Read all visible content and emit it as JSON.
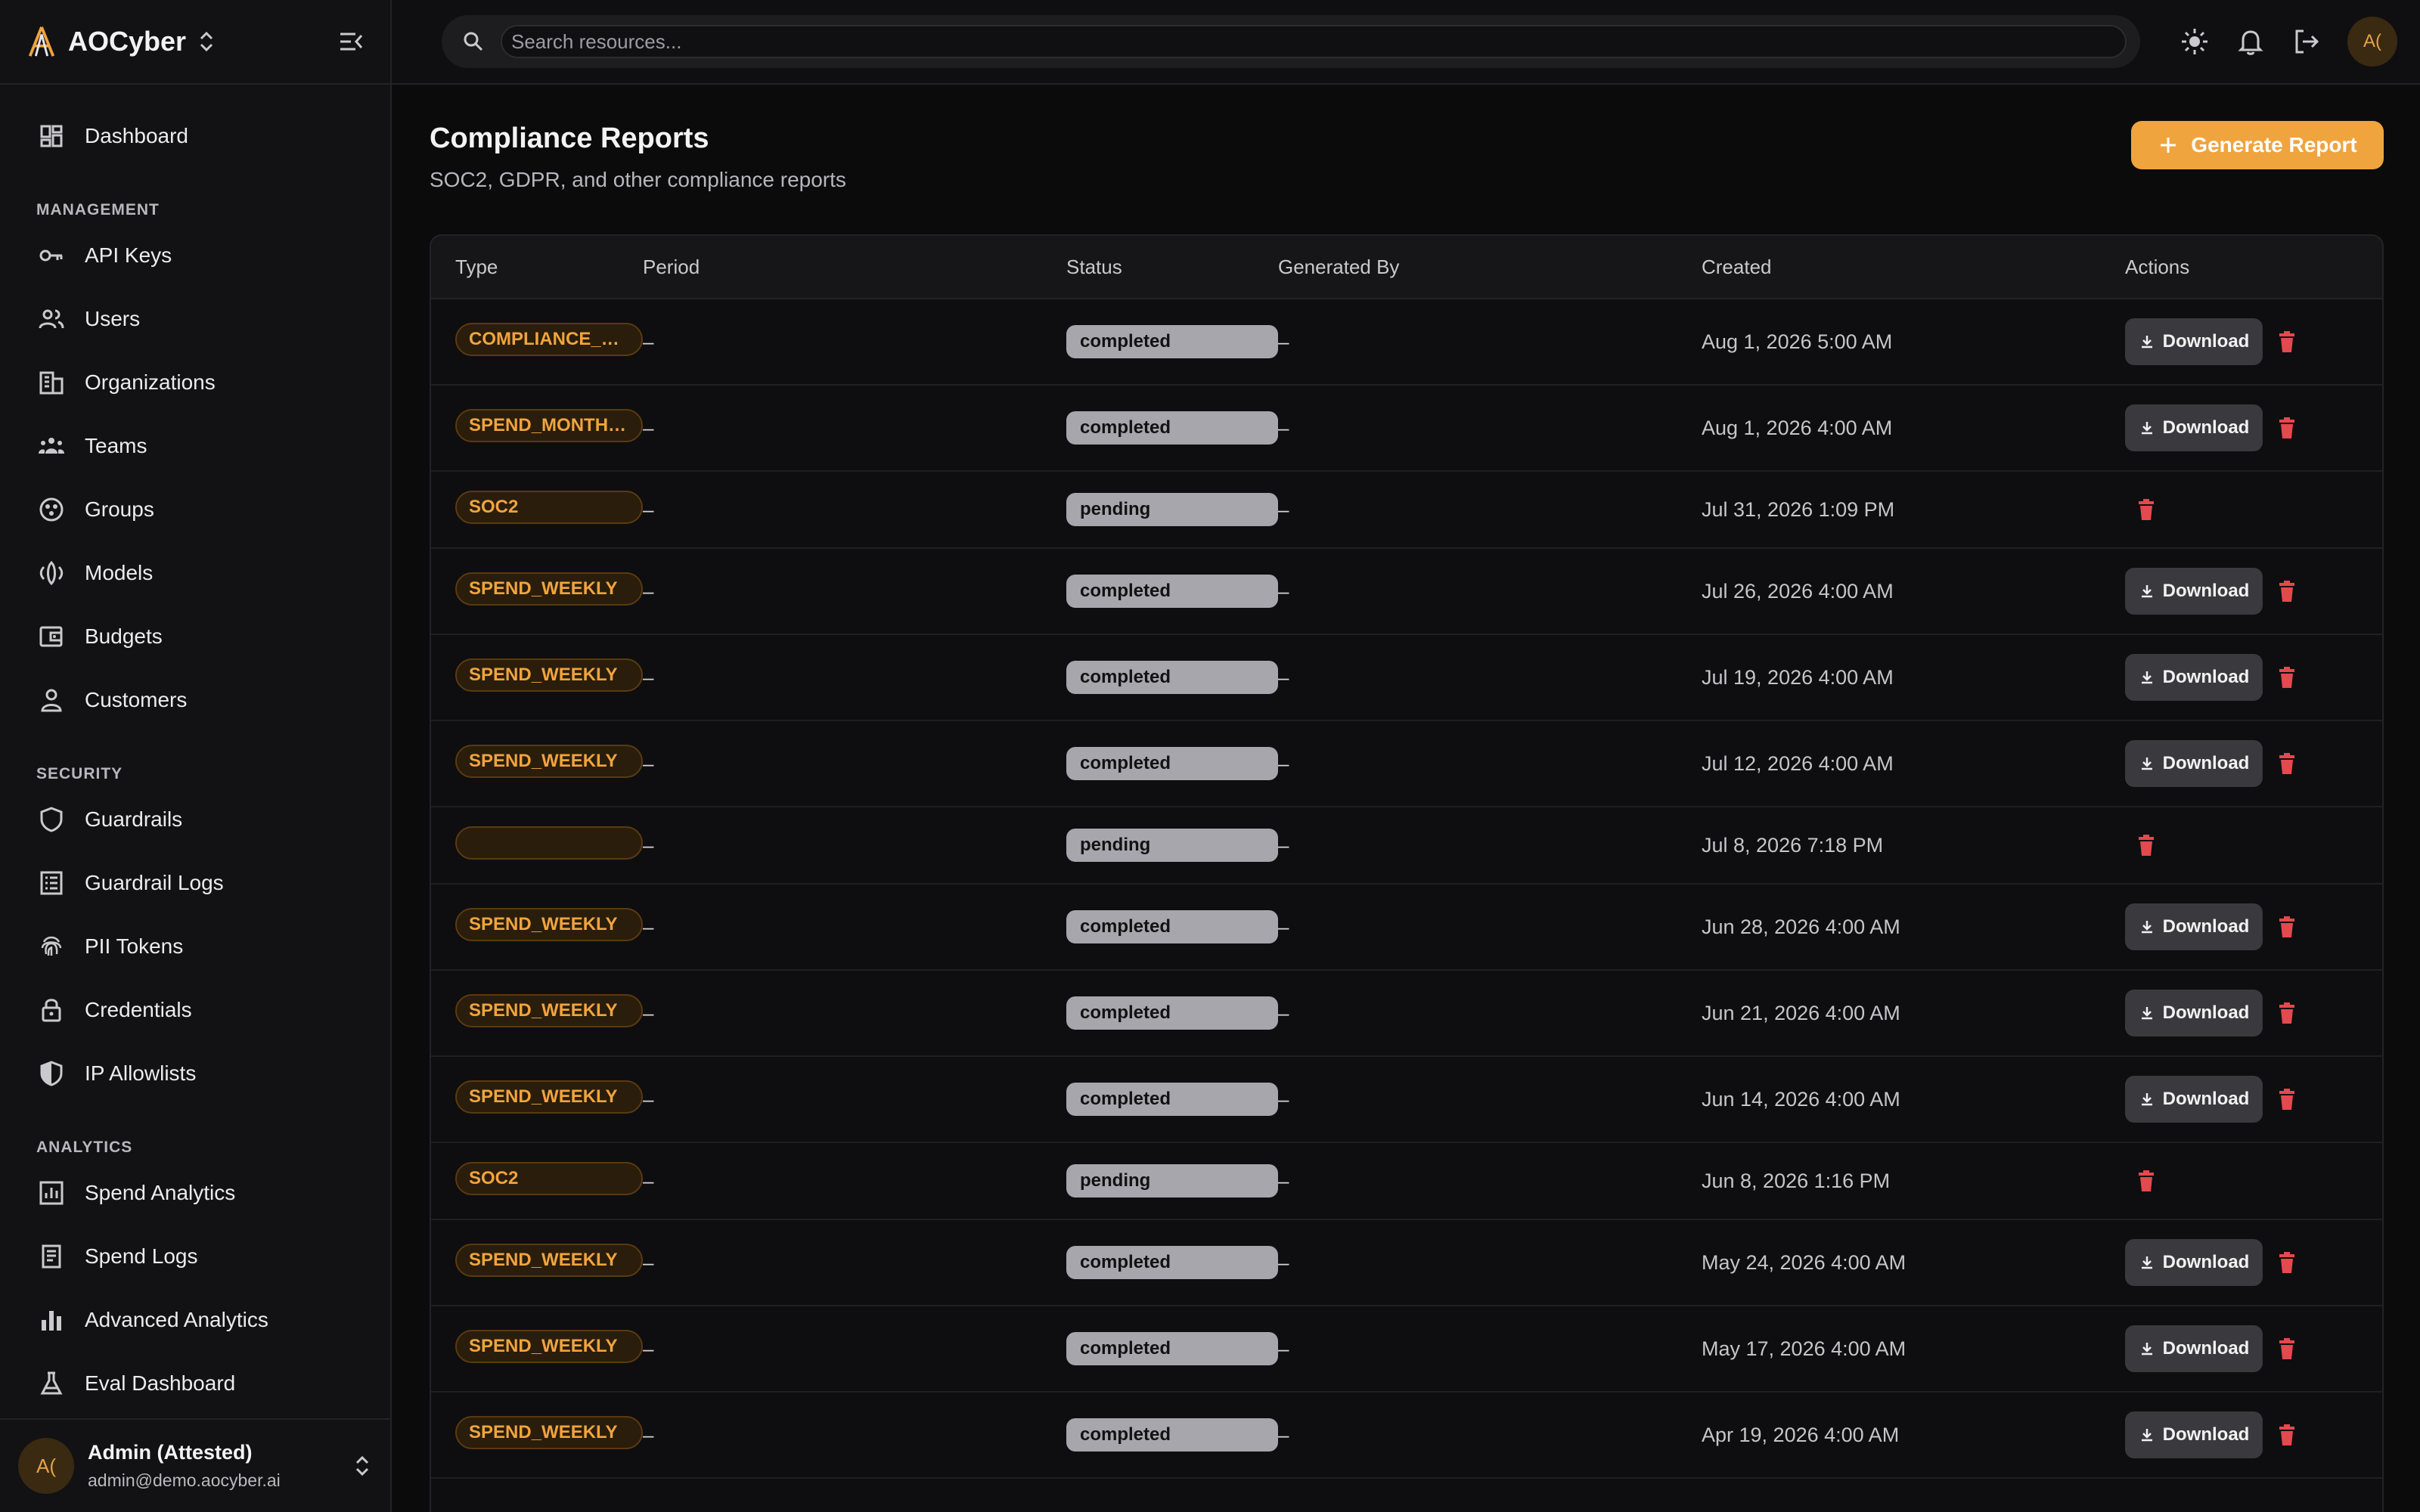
{
  "app": {
    "name": "AOCyber"
  },
  "sidebar": {
    "top": [
      {
        "label": "Dashboard",
        "icon": "dashboard-icon"
      }
    ],
    "management_label": "MANAGEMENT",
    "management": [
      {
        "label": "API Keys",
        "icon": "key-icon"
      },
      {
        "label": "Users",
        "icon": "users-icon"
      },
      {
        "label": "Organizations",
        "icon": "building-icon"
      },
      {
        "label": "Teams",
        "icon": "team-icon"
      },
      {
        "label": "Groups",
        "icon": "groups-icon"
      },
      {
        "label": "Models",
        "icon": "models-icon"
      },
      {
        "label": "Budgets",
        "icon": "wallet-icon"
      },
      {
        "label": "Customers",
        "icon": "person-icon"
      }
    ],
    "security_label": "SECURITY",
    "security": [
      {
        "label": "Guardrails",
        "icon": "shield-icon"
      },
      {
        "label": "Guardrail Logs",
        "icon": "log-icon"
      },
      {
        "label": "PII Tokens",
        "icon": "fingerprint-icon"
      },
      {
        "label": "Credentials",
        "icon": "lock-icon"
      },
      {
        "label": "IP Allowlists",
        "icon": "shield-half-icon"
      }
    ],
    "analytics_label": "ANALYTICS",
    "analytics": [
      {
        "label": "Spend Analytics",
        "icon": "chart-box-icon"
      },
      {
        "label": "Spend Logs",
        "icon": "receipt-icon"
      },
      {
        "label": "Advanced Analytics",
        "icon": "bar-chart-icon"
      },
      {
        "label": "Eval Dashboard",
        "icon": "flask-icon"
      }
    ]
  },
  "user": {
    "initials": "A(",
    "name": "Admin (Attested)",
    "email": "admin@demo.aocyber.ai"
  },
  "search": {
    "placeholder": "Search resources..."
  },
  "page": {
    "title": "Compliance Reports",
    "subtitle": "SOC2, GDPR, and other compliance reports",
    "generate_label": "Generate Report"
  },
  "table": {
    "headers": {
      "type": "Type",
      "period": "Period",
      "status": "Status",
      "generated_by": "Generated By",
      "created": "Created",
      "actions": "Actions"
    },
    "download_label": "Download",
    "rows": [
      {
        "type": "COMPLIANCE_MONTHLY",
        "period": "–",
        "status": "completed",
        "generated_by": "–",
        "created": "Aug 1, 2026 5:00 AM",
        "download": true
      },
      {
        "type": "SPEND_MONTHLY",
        "period": "–",
        "status": "completed",
        "generated_by": "–",
        "created": "Aug 1, 2026 4:00 AM",
        "download": true
      },
      {
        "type": "SOC2",
        "period": "–",
        "status": "pending",
        "generated_by": "–",
        "created": "Jul 31, 2026 1:09 PM",
        "download": false
      },
      {
        "type": "SPEND_WEEKLY",
        "period": "–",
        "status": "completed",
        "generated_by": "–",
        "created": "Jul 26, 2026 4:00 AM",
        "download": true
      },
      {
        "type": "SPEND_WEEKLY",
        "period": "–",
        "status": "completed",
        "generated_by": "–",
        "created": "Jul 19, 2026 4:00 AM",
        "download": true
      },
      {
        "type": "SPEND_WEEKLY",
        "period": "–",
        "status": "completed",
        "generated_by": "–",
        "created": "Jul 12, 2026 4:00 AM",
        "download": true
      },
      {
        "type": "",
        "period": "–",
        "status": "pending",
        "generated_by": "–",
        "created": "Jul 8, 2026 7:18 PM",
        "download": false
      },
      {
        "type": "SPEND_WEEKLY",
        "period": "–",
        "status": "completed",
        "generated_by": "–",
        "created": "Jun 28, 2026 4:00 AM",
        "download": true
      },
      {
        "type": "SPEND_WEEKLY",
        "period": "–",
        "status": "completed",
        "generated_by": "–",
        "created": "Jun 21, 2026 4:00 AM",
        "download": true
      },
      {
        "type": "SPEND_WEEKLY",
        "period": "–",
        "status": "completed",
        "generated_by": "–",
        "created": "Jun 14, 2026 4:00 AM",
        "download": true
      },
      {
        "type": "SOC2",
        "period": "–",
        "status": "pending",
        "generated_by": "–",
        "created": "Jun 8, 2026 1:16 PM",
        "download": false
      },
      {
        "type": "SPEND_WEEKLY",
        "period": "–",
        "status": "completed",
        "generated_by": "–",
        "created": "May 24, 2026 4:00 AM",
        "download": true
      },
      {
        "type": "SPEND_WEEKLY",
        "period": "–",
        "status": "completed",
        "generated_by": "–",
        "created": "May 17, 2026 4:00 AM",
        "download": true
      },
      {
        "type": "SPEND_WEEKLY",
        "period": "–",
        "status": "completed",
        "generated_by": "–",
        "created": "Apr 19, 2026 4:00 AM",
        "download": true
      }
    ]
  },
  "colors": {
    "accent": "#f0a43e",
    "delete": "#e5484d",
    "badge_grey": "#a6a6ac"
  }
}
